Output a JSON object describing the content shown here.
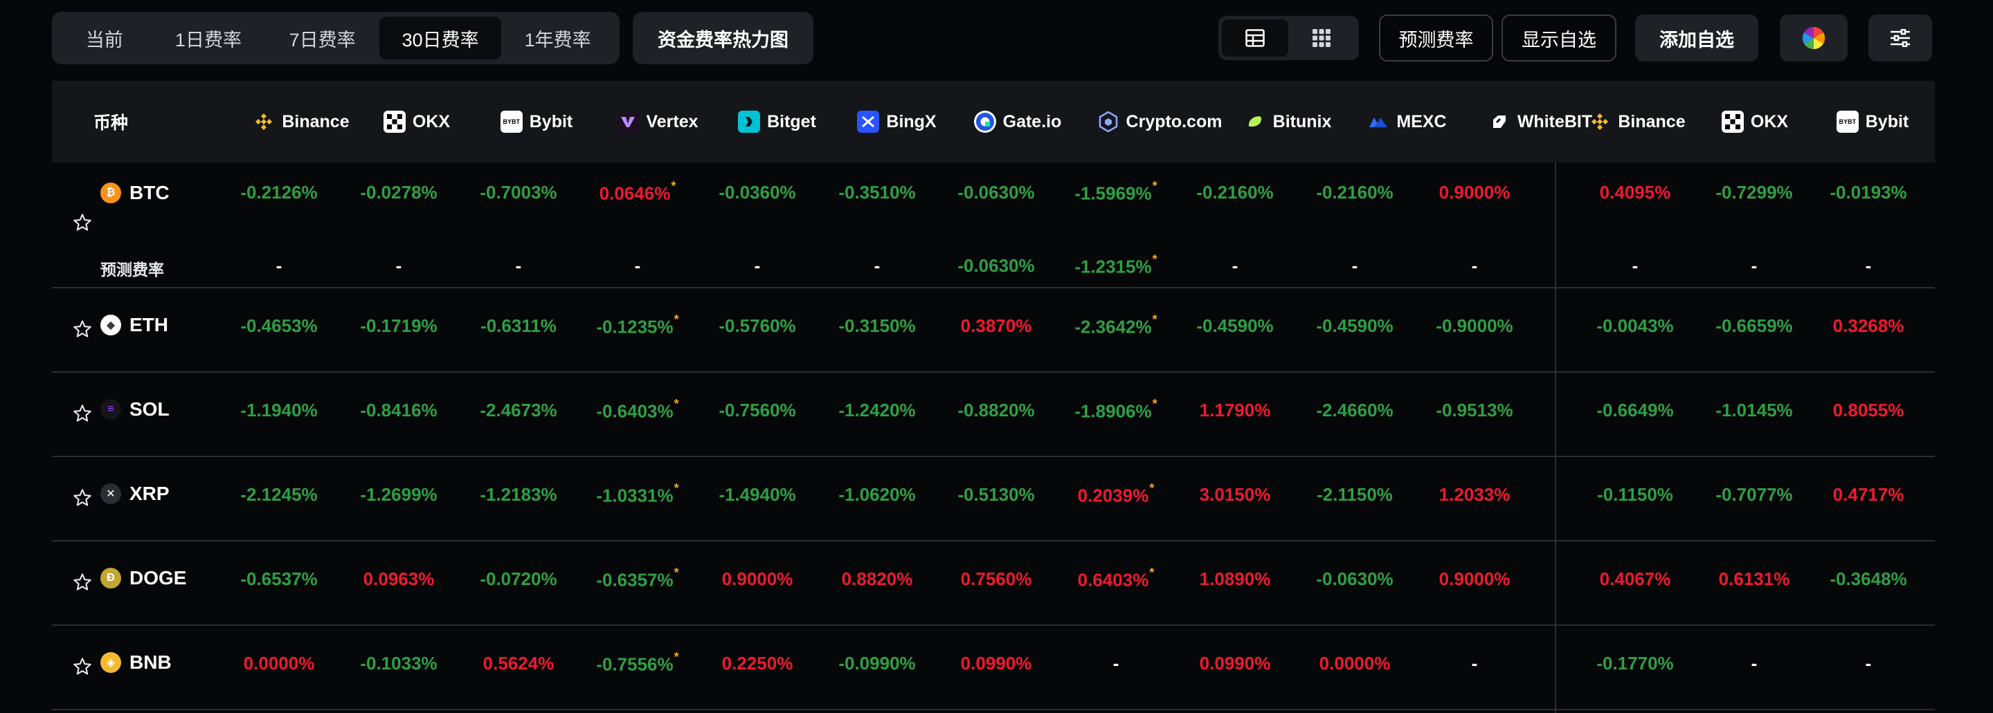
{
  "toolbar": {
    "tabs": [
      {
        "label": "当前",
        "active": false
      },
      {
        "label": "1日费率",
        "active": false
      },
      {
        "label": "7日费率",
        "active": false
      },
      {
        "label": "30日费率",
        "active": true
      },
      {
        "label": "1年费率",
        "active": false
      }
    ],
    "heatmap_label": "资金费率热力图",
    "view_modes": [
      "table-icon",
      "grid-icon"
    ],
    "predict_label": "预测费率",
    "show_fav_label": "显示自选",
    "add_fav_label": "添加自选",
    "color_icon": "color-wheel-icon",
    "filter_icon": "sliders-icon"
  },
  "table": {
    "coin_header": "币种",
    "exchanges": [
      "Binance",
      "OKX",
      "Bybit",
      "Vertex",
      "Bitget",
      "BingX",
      "Gate.io",
      "Crypto.com",
      "Bitunix",
      "MEXC",
      "WhiteBIT",
      "Binance",
      "OKX",
      "Bybit"
    ],
    "predicted_label": "预测费率",
    "colors": {
      "positive": "#f0192e",
      "negative": "#2ea043",
      "asterisk": "#f5a623"
    },
    "rows": [
      {
        "coin": "BTC",
        "values": [
          "-0.2126%",
          "-0.0278%",
          "-0.7003%",
          "0.0646%",
          "-0.0360%",
          "-0.3510%",
          "-0.0630%",
          "-1.5969%",
          "-0.2160%",
          "-0.2160%",
          "0.9000%",
          "0.4095%",
          "-0.7299%",
          "-0.0193%"
        ],
        "predicted": [
          "-",
          "-",
          "-",
          "-",
          "-",
          "-",
          "-0.0630%",
          "-1.2315%",
          "-",
          "-",
          "-",
          "-",
          "-",
          "-"
        ]
      },
      {
        "coin": "ETH",
        "values": [
          "-0.4653%",
          "-0.1719%",
          "-0.6311%",
          "-0.1235%",
          "-0.5760%",
          "-0.3150%",
          "0.3870%",
          "-2.3642%",
          "-0.4590%",
          "-0.4590%",
          "-0.9000%",
          "-0.0043%",
          "-0.6659%",
          "0.3268%"
        ]
      },
      {
        "coin": "SOL",
        "values": [
          "-1.1940%",
          "-0.8416%",
          "-2.4673%",
          "-0.6403%",
          "-0.7560%",
          "-1.2420%",
          "-0.8820%",
          "-1.8906%",
          "1.1790%",
          "-2.4660%",
          "-0.9513%",
          "-0.6649%",
          "-1.0145%",
          "0.8055%"
        ]
      },
      {
        "coin": "XRP",
        "values": [
          "-2.1245%",
          "-1.2699%",
          "-1.2183%",
          "-1.0331%",
          "-1.4940%",
          "-1.0620%",
          "-0.5130%",
          "0.2039%",
          "3.0150%",
          "-2.1150%",
          "1.2033%",
          "-0.1150%",
          "-0.7077%",
          "0.4717%"
        ]
      },
      {
        "coin": "DOGE",
        "values": [
          "-0.6537%",
          "0.0963%",
          "-0.0720%",
          "-0.6357%",
          "0.9000%",
          "0.8820%",
          "0.7560%",
          "0.6403%",
          "1.0890%",
          "-0.0630%",
          "0.9000%",
          "0.4067%",
          "0.6131%",
          "-0.3648%"
        ]
      },
      {
        "coin": "BNB",
        "values": [
          "0.0000%",
          "-0.1033%",
          "0.5624%",
          "-0.7556%",
          "0.2250%",
          "-0.0990%",
          "0.0990%",
          "-",
          "0.0990%",
          "0.0000%",
          "-",
          "-0.1770%",
          "-",
          "-"
        ]
      }
    ]
  }
}
